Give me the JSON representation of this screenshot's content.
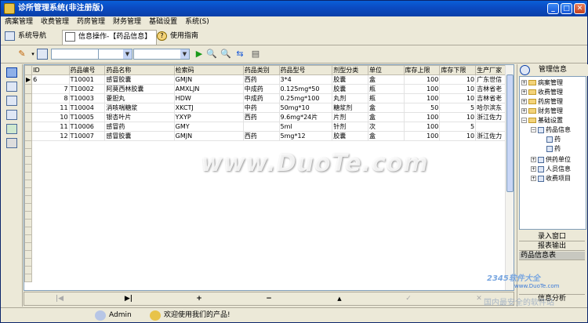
{
  "app": {
    "title": "诊所管理系统(非注册版)"
  },
  "menu": [
    "病案管理",
    "收费管理",
    "药房管理",
    "财务管理",
    "基础设置",
    "系统(S)"
  ],
  "tabs": [
    {
      "label": "系统导航"
    },
    {
      "label": "信息操作-【药品信息】"
    },
    {
      "label": "使用指南"
    }
  ],
  "grid": {
    "columns": [
      "ID",
      "药品编号",
      "药品名称",
      "检索码",
      "药品类别",
      "药品型号",
      "剂型分类",
      "单位",
      "库存上限",
      "库存下限",
      "生产厂家"
    ],
    "rows": [
      [
        "6",
        "T10001",
        "感冒胶囊",
        "GMJN",
        "西药",
        "3*4",
        "胶囊",
        "盒",
        "100",
        "10",
        "广东世信"
      ],
      [
        "7",
        "T10002",
        "阿莫西林胶囊",
        "AMXLJN",
        "中成药",
        "0.125mg*50",
        "胶囊",
        "瓶",
        "100",
        "10",
        "吉林省老"
      ],
      [
        "8",
        "T10003",
        "藿胆丸",
        "HDW",
        "中成药",
        "0.25mg*100",
        "丸剂",
        "瓶",
        "100",
        "10",
        "吉林省老"
      ],
      [
        "11",
        "T10004",
        "消咳喘糖浆",
        "XKCTJ",
        "中药",
        "50mg*10",
        "糖浆剂",
        "盒",
        "50",
        "5",
        "哈尔滨东"
      ],
      [
        "10",
        "T10005",
        "银杏叶片",
        "YXYP",
        "西药",
        "9.6mg*24片",
        "片剂",
        "盒",
        "100",
        "10",
        "浙江佐力"
      ],
      [
        "11",
        "T10006",
        "感冒药",
        "GMY",
        "",
        "5ml",
        "针剂",
        "次",
        "100",
        "5",
        ""
      ],
      [
        "12",
        "T10007",
        "感冒胶囊",
        "GMJN",
        "西药",
        "5mg*12",
        "胶囊",
        "盒",
        "100",
        "10",
        "浙江佐力"
      ]
    ]
  },
  "right_panel": {
    "title": "管理信息",
    "tree": [
      {
        "label": "病案管理"
      },
      {
        "label": "收费管理"
      },
      {
        "label": "药房管理"
      },
      {
        "label": "财务管理"
      },
      {
        "label": "基础设置"
      },
      {
        "label": "药品信息"
      },
      {
        "label": "药"
      },
      {
        "label": "药"
      },
      {
        "label": "供药单位"
      },
      {
        "label": "人员信息"
      },
      {
        "label": "收费项目"
      }
    ],
    "buttons": [
      "录入窗口",
      "报表输出",
      "药品信息表"
    ],
    "bottom_label": "信息分析"
  },
  "status": {
    "user": "Admin",
    "message": "欢迎使用我们的产品!"
  },
  "watermark": {
    "main": "www.DuoTe.com",
    "brand": "2345软件大全",
    "brand_url": "www.DuoTe.com",
    "footer": "国内最安全的软件站"
  }
}
